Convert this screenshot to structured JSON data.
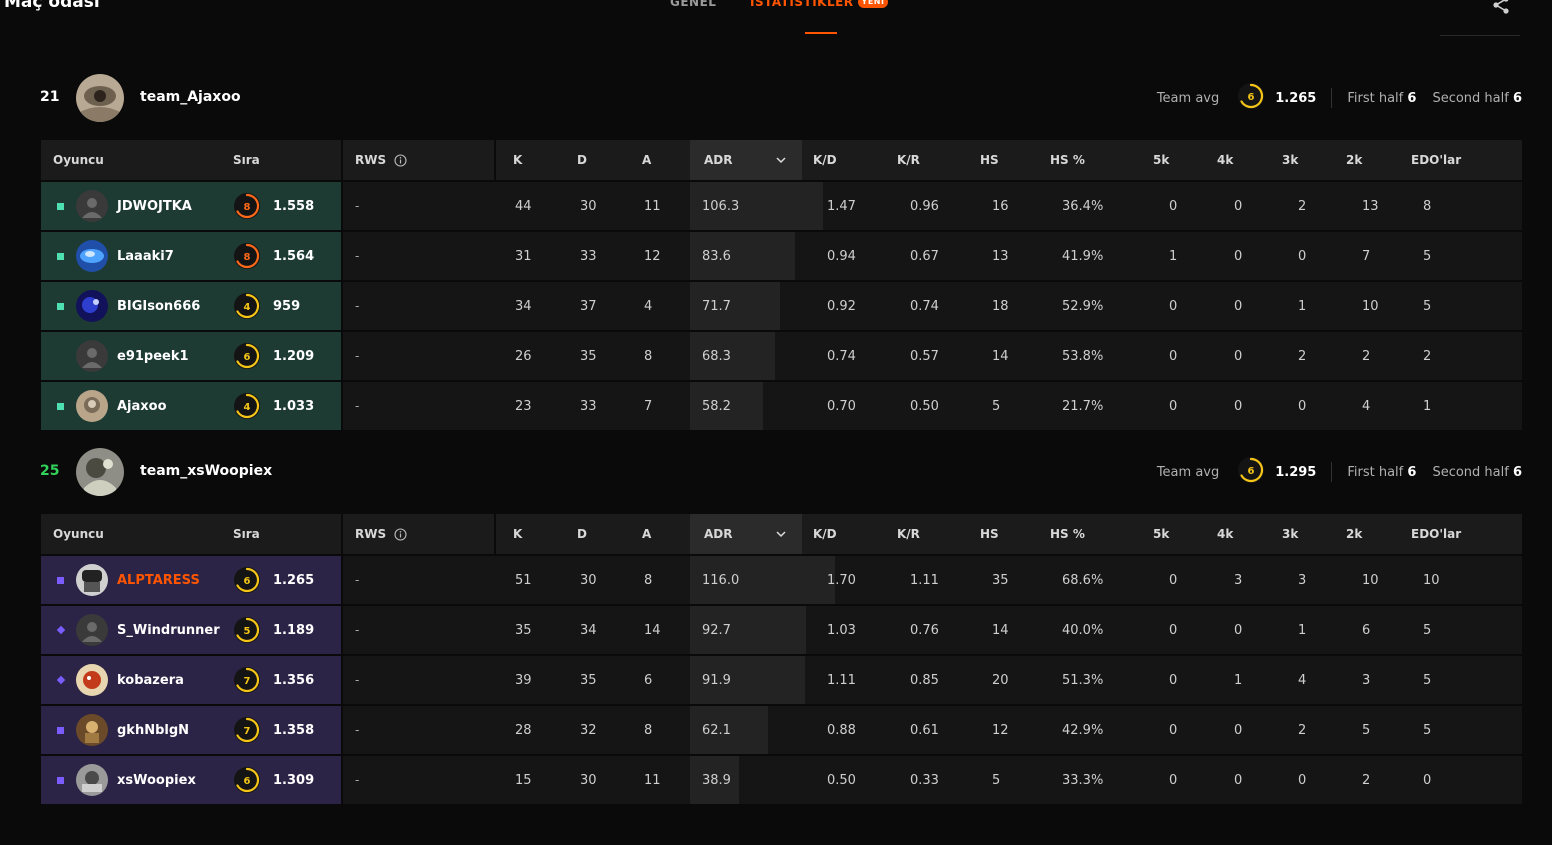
{
  "header": {
    "title": "Maç odası",
    "tabs": [
      {
        "label": "GENEL"
      },
      {
        "label": "İSTATİSTİKLER",
        "badge": "YENİ",
        "active": true
      }
    ]
  },
  "columns": {
    "player": "Oyuncu",
    "rank": "Sıra",
    "rws": "RWS",
    "k": "K",
    "d": "D",
    "a": "A",
    "adr": "ADR",
    "kd": "K/D",
    "kr": "K/R",
    "hs": "HS",
    "hsp": "HS %",
    "k5": "5k",
    "k4": "4k",
    "k3": "3k",
    "k2": "2k",
    "edo": "EDO'lar"
  },
  "teams": [
    {
      "score": "21",
      "name": "team_Ajaxoo",
      "team_avg_label": "Team avg",
      "avg_level": "6",
      "avg_elo": "1.265",
      "first_half_label": "First half",
      "first_half": "6",
      "second_half_label": "Second half",
      "second_half": "6",
      "score_color": "#ffffff",
      "row_color": "#1d3b33",
      "marker_color": "#4fe0b0",
      "players": [
        {
          "name": "JDWOJTKA",
          "level": "8",
          "elo": "1.558",
          "rws": "-",
          "k": "44",
          "d": "30",
          "a": "11",
          "adr": "106.3",
          "kd": "1.47",
          "kr": "0.96",
          "hs": "16",
          "hsp": "36.4%",
          "k5": "0",
          "k4": "0",
          "k3": "2",
          "k2": "13",
          "edo": "8",
          "avatar": "default",
          "marker": "square"
        },
        {
          "name": "Laaaki7",
          "level": "8",
          "elo": "1.564",
          "rws": "-",
          "k": "31",
          "d": "33",
          "a": "12",
          "adr": "83.6",
          "kd": "0.94",
          "kr": "0.67",
          "hs": "13",
          "hsp": "41.9%",
          "k5": "1",
          "k4": "0",
          "k3": "0",
          "k2": "7",
          "edo": "5",
          "avatar": "blue",
          "marker": "square"
        },
        {
          "name": "BIGIson666",
          "level": "4",
          "elo": "959",
          "rws": "-",
          "k": "34",
          "d": "37",
          "a": "4",
          "adr": "71.7",
          "kd": "0.92",
          "kr": "0.74",
          "hs": "18",
          "hsp": "52.9%",
          "k5": "0",
          "k4": "0",
          "k3": "1",
          "k2": "10",
          "edo": "5",
          "avatar": "navy",
          "marker": "square"
        },
        {
          "name": "e91peek1",
          "level": "6",
          "elo": "1.209",
          "rws": "-",
          "k": "26",
          "d": "35",
          "a": "8",
          "adr": "68.3",
          "kd": "0.74",
          "kr": "0.57",
          "hs": "14",
          "hsp": "53.8%",
          "k5": "0",
          "k4": "0",
          "k3": "2",
          "k2": "2",
          "edo": "2",
          "avatar": "default",
          "marker": "none"
        },
        {
          "name": "Ajaxoo",
          "level": "4",
          "elo": "1.033",
          "rws": "-",
          "k": "23",
          "d": "33",
          "a": "7",
          "adr": "58.2",
          "kd": "0.70",
          "kr": "0.50",
          "hs": "5",
          "hsp": "21.7%",
          "k5": "0",
          "k4": "0",
          "k3": "0",
          "k2": "4",
          "edo": "1",
          "avatar": "tan",
          "marker": "square"
        }
      ]
    },
    {
      "score": "25",
      "name": "team_xsWoopiex",
      "team_avg_label": "Team avg",
      "avg_level": "6",
      "avg_elo": "1.295",
      "first_half_label": "First half",
      "first_half": "6",
      "second_half_label": "Second half",
      "second_half": "6",
      "score_color": "#32d35a",
      "row_color": "#2b2446",
      "marker_color": "#7b5cff",
      "players": [
        {
          "name": "ALPTARESS",
          "level": "6",
          "elo": "1.265",
          "rws": "-",
          "k": "51",
          "d": "30",
          "a": "8",
          "adr": "116.0",
          "kd": "1.70",
          "kr": "1.11",
          "hs": "35",
          "hsp": "68.6%",
          "k5": "0",
          "k4": "3",
          "k3": "3",
          "k2": "10",
          "edo": "10",
          "avatar": "bw",
          "marker": "square",
          "highlight": true
        },
        {
          "name": "S_Windrunner",
          "level": "5",
          "elo": "1.189",
          "rws": "-",
          "k": "35",
          "d": "34",
          "a": "14",
          "adr": "92.7",
          "kd": "1.03",
          "kr": "0.76",
          "hs": "14",
          "hsp": "40.0%",
          "k5": "0",
          "k4": "0",
          "k3": "1",
          "k2": "6",
          "edo": "5",
          "avatar": "default",
          "marker": "diamond"
        },
        {
          "name": "kobazera",
          "level": "7",
          "elo": "1.356",
          "rws": "-",
          "k": "39",
          "d": "35",
          "a": "6",
          "adr": "91.9",
          "kd": "1.11",
          "kr": "0.85",
          "hs": "20",
          "hsp": "51.3%",
          "k5": "0",
          "k4": "1",
          "k3": "4",
          "k2": "3",
          "edo": "5",
          "avatar": "red",
          "marker": "diamond"
        },
        {
          "name": "gkhNblgN",
          "level": "7",
          "elo": "1.358",
          "rws": "-",
          "k": "28",
          "d": "32",
          "a": "8",
          "adr": "62.1",
          "kd": "0.88",
          "kr": "0.61",
          "hs": "12",
          "hsp": "42.9%",
          "k5": "0",
          "k4": "0",
          "k3": "2",
          "k2": "5",
          "edo": "5",
          "avatar": "brown",
          "marker": "square"
        },
        {
          "name": "xsWoopiex",
          "level": "6",
          "elo": "1.309",
          "rws": "-",
          "k": "15",
          "d": "30",
          "a": "11",
          "adr": "38.9",
          "kd": "0.50",
          "kr": "0.33",
          "hs": "5",
          "hsp": "33.3%",
          "k5": "0",
          "k4": "0",
          "k3": "0",
          "k2": "2",
          "edo": "0",
          "avatar": "grey",
          "marker": "square"
        }
      ]
    }
  ],
  "icons": {
    "share": "share-icon",
    "info": "info-icon",
    "sort": "chevron-down-icon"
  },
  "colors": {
    "accent": "#ff5500",
    "level_4_to_7": "#f5c518",
    "level_8": "#ff6a1a"
  }
}
